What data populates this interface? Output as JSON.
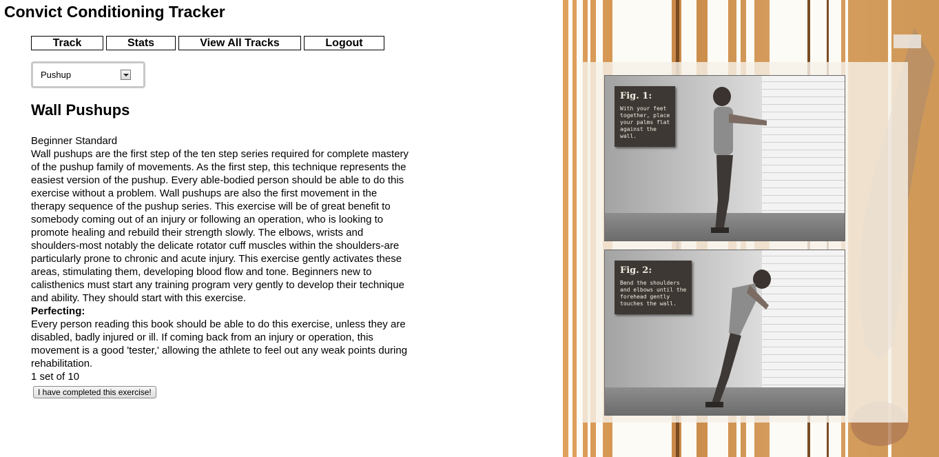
{
  "app": {
    "title": "Convict Conditioning Tracker"
  },
  "nav": {
    "items": [
      {
        "label": "Track"
      },
      {
        "label": "Stats"
      },
      {
        "label": "View All Tracks"
      },
      {
        "label": "Logout"
      }
    ]
  },
  "exercise_select": {
    "selected": "Pushup"
  },
  "exercise": {
    "title": "Wall Pushups",
    "standard": "Beginner Standard",
    "description": "Wall pushups are the first step of the ten step series required for complete mastery of the pushup family of movements. As the first step, this technique represents the easiest version of the pushup. Every able-bodied person should be able to do this exercise without a problem. Wall pushups are also the first movement in the therapy sequence of the pushup series. This exercise will be of great benefit to somebody coming out of an injury or following an operation, who is looking to promote healing and rebuild their strength slowly. The elbows, wrists and shoulders-most notably the delicate rotator cuff muscles within the shoulders-are particularly prone to chronic and acute injury. This exercise gently activates these areas, stimulating them, developing blood flow and tone. Beginners new to calisthenics must start any training program very gently to develop their technique and ability. They should start with this exercise.",
    "perfecting_heading": "Perfecting:",
    "perfecting_text": "Every person reading this book should be able to do this exercise, unless they are disabled, badly injured or ill. If coming back from an injury or operation, this movement is a good 'tester,' allowing the athlete to feel out any weak points during rehabilitation.",
    "sets": "1 set of 10",
    "complete_button": "I have completed this exercise!"
  },
  "figures": [
    {
      "title": "Fig. 1:",
      "text": "With your feet\ntogether, place\nyour palms flat\nagainst the\nwall."
    },
    {
      "title": "Fig. 2:",
      "text": "Bend the shoulders\nand elbows until the\nforehead gently\ntouches the wall."
    }
  ],
  "colors": {
    "background": "#ffffff",
    "art_background": "#d49a5a",
    "panel": "#f5f0e8",
    "caption_box": "#3e3834"
  }
}
